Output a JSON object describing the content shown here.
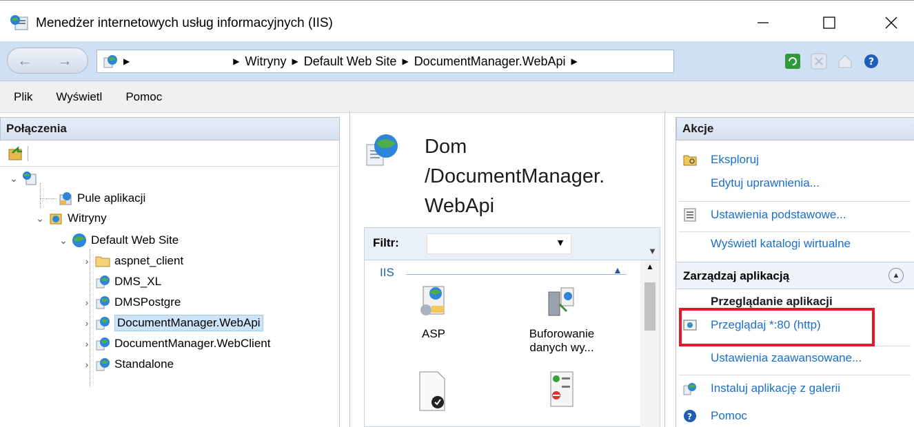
{
  "window": {
    "title": "Menedżer internetowych usług informacyjnych (IIS)",
    "min_glyph": "—",
    "max_glyph": "☐",
    "close_glyph": "✕"
  },
  "address": {
    "back_glyph": "←",
    "forward_glyph": "→",
    "segments": [
      "Witryny",
      "Default Web Site",
      "DocumentManager.WebApi"
    ],
    "sep_glyph": "▶"
  },
  "menu": {
    "items": [
      "Plik",
      "Wyświetl",
      "Pomoc"
    ]
  },
  "connections": {
    "header": "Połączenia",
    "tree": [
      {
        "label": "Pule aplikacji",
        "icon": "app-pool-icon"
      },
      {
        "label": "Witryny",
        "icon": "sites-icon"
      },
      {
        "label": "Default Web Site",
        "icon": "globe-icon"
      },
      {
        "label": "aspnet_client",
        "icon": "folder-icon"
      },
      {
        "label": "DMS_XL",
        "icon": "web-app-icon"
      },
      {
        "label": "DMSPostgre",
        "icon": "web-app-icon"
      },
      {
        "label": "DocumentManager.WebApi",
        "icon": "web-app-icon"
      },
      {
        "label": "DocumentManager.WebClient",
        "icon": "web-app-icon"
      },
      {
        "label": "Standalone",
        "icon": "web-app-icon"
      }
    ]
  },
  "main": {
    "title_line1": "Dom",
    "title_line2": "/DocumentManager.",
    "title_line3": "WebApi",
    "filter_label": "Filtr:",
    "group_label": "IIS",
    "features": [
      {
        "label": "ASP",
        "icon": "asp-icon"
      },
      {
        "label": "Buforowanie danych wy...",
        "icon": "output-cache-icon"
      }
    ]
  },
  "actions": {
    "header": "Akcje",
    "explore": "Eksploruj",
    "edit_permissions": "Edytuj uprawnienia...",
    "basic_settings": "Ustawienia podstawowe...",
    "view_virtual_dirs": "Wyświetl katalogi wirtualne",
    "manage_app": "Zarządzaj aplikacją",
    "browse_app": "Przeglądanie aplikacji",
    "browse_80": "Przeglądaj *:80 (http)",
    "advanced_settings": "Ustawienia zaawansowane...",
    "install_gallery": "Instaluj aplikację z galerii",
    "help": "Pomoc"
  },
  "colors": {
    "link": "#1a6fc9",
    "highlight_box": "#e21b2a",
    "selection": "#cce4f7"
  }
}
